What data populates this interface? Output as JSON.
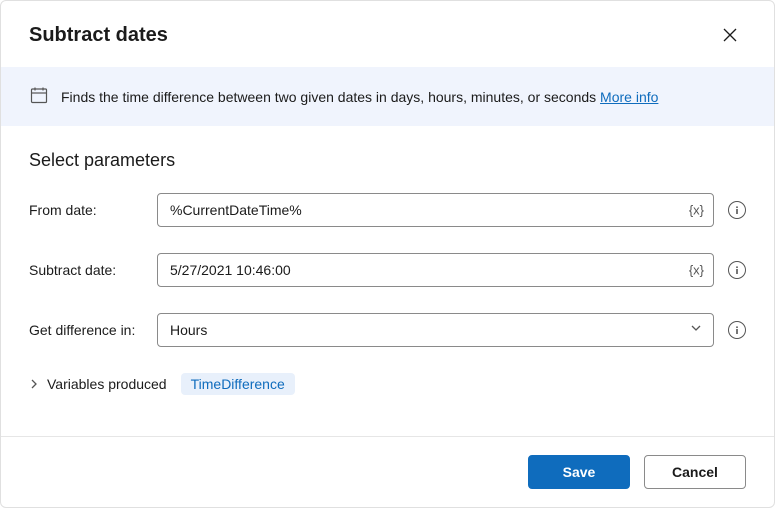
{
  "dialog": {
    "title": "Subtract dates"
  },
  "banner": {
    "text": "Finds the time difference between two given dates in days, hours, minutes, or seconds",
    "more_info": "More info"
  },
  "section": {
    "title": "Select parameters"
  },
  "fields": {
    "from_date": {
      "label": "From date:",
      "value": "%CurrentDateTime%"
    },
    "subtract_date": {
      "label": "Subtract date:",
      "value": "5/27/2021 10:46:00"
    },
    "difference_in": {
      "label": "Get difference in:",
      "value": "Hours"
    }
  },
  "variables": {
    "label": "Variables produced",
    "badge": "TimeDifference"
  },
  "footer": {
    "save": "Save",
    "cancel": "Cancel"
  },
  "icons": {
    "variable_token": "{x}"
  }
}
